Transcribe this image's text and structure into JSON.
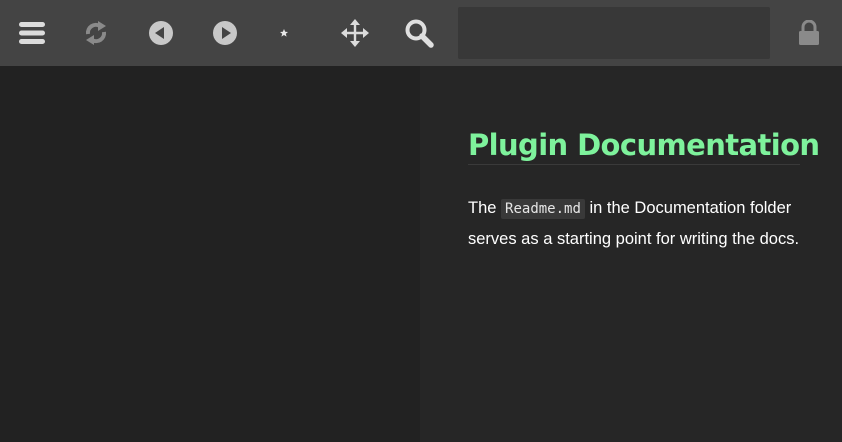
{
  "toolbar": {
    "items": [
      {
        "icon": "menu-icon"
      },
      {
        "icon": "sync-icon"
      },
      {
        "icon": "back-icon"
      },
      {
        "icon": "forward-icon"
      },
      {
        "icon": "theme-icon"
      },
      {
        "icon": "move-icon"
      },
      {
        "icon": "search-icon"
      },
      {
        "icon": "lock-icon"
      }
    ],
    "search": {
      "value": "",
      "placeholder": ""
    },
    "colors": {
      "background": "#444444",
      "icon": "#dcdcdc",
      "icon_dim": "#9a9a9a"
    }
  },
  "document": {
    "title": "Plugin Documentation",
    "paragraph": {
      "before": "The ",
      "code": "Readme.md",
      "after": " in the Documentation folder serves as a starting point for writing the docs."
    },
    "colors": {
      "title": "#7ef29c",
      "text": "#ffffff",
      "background": "#262626"
    }
  }
}
